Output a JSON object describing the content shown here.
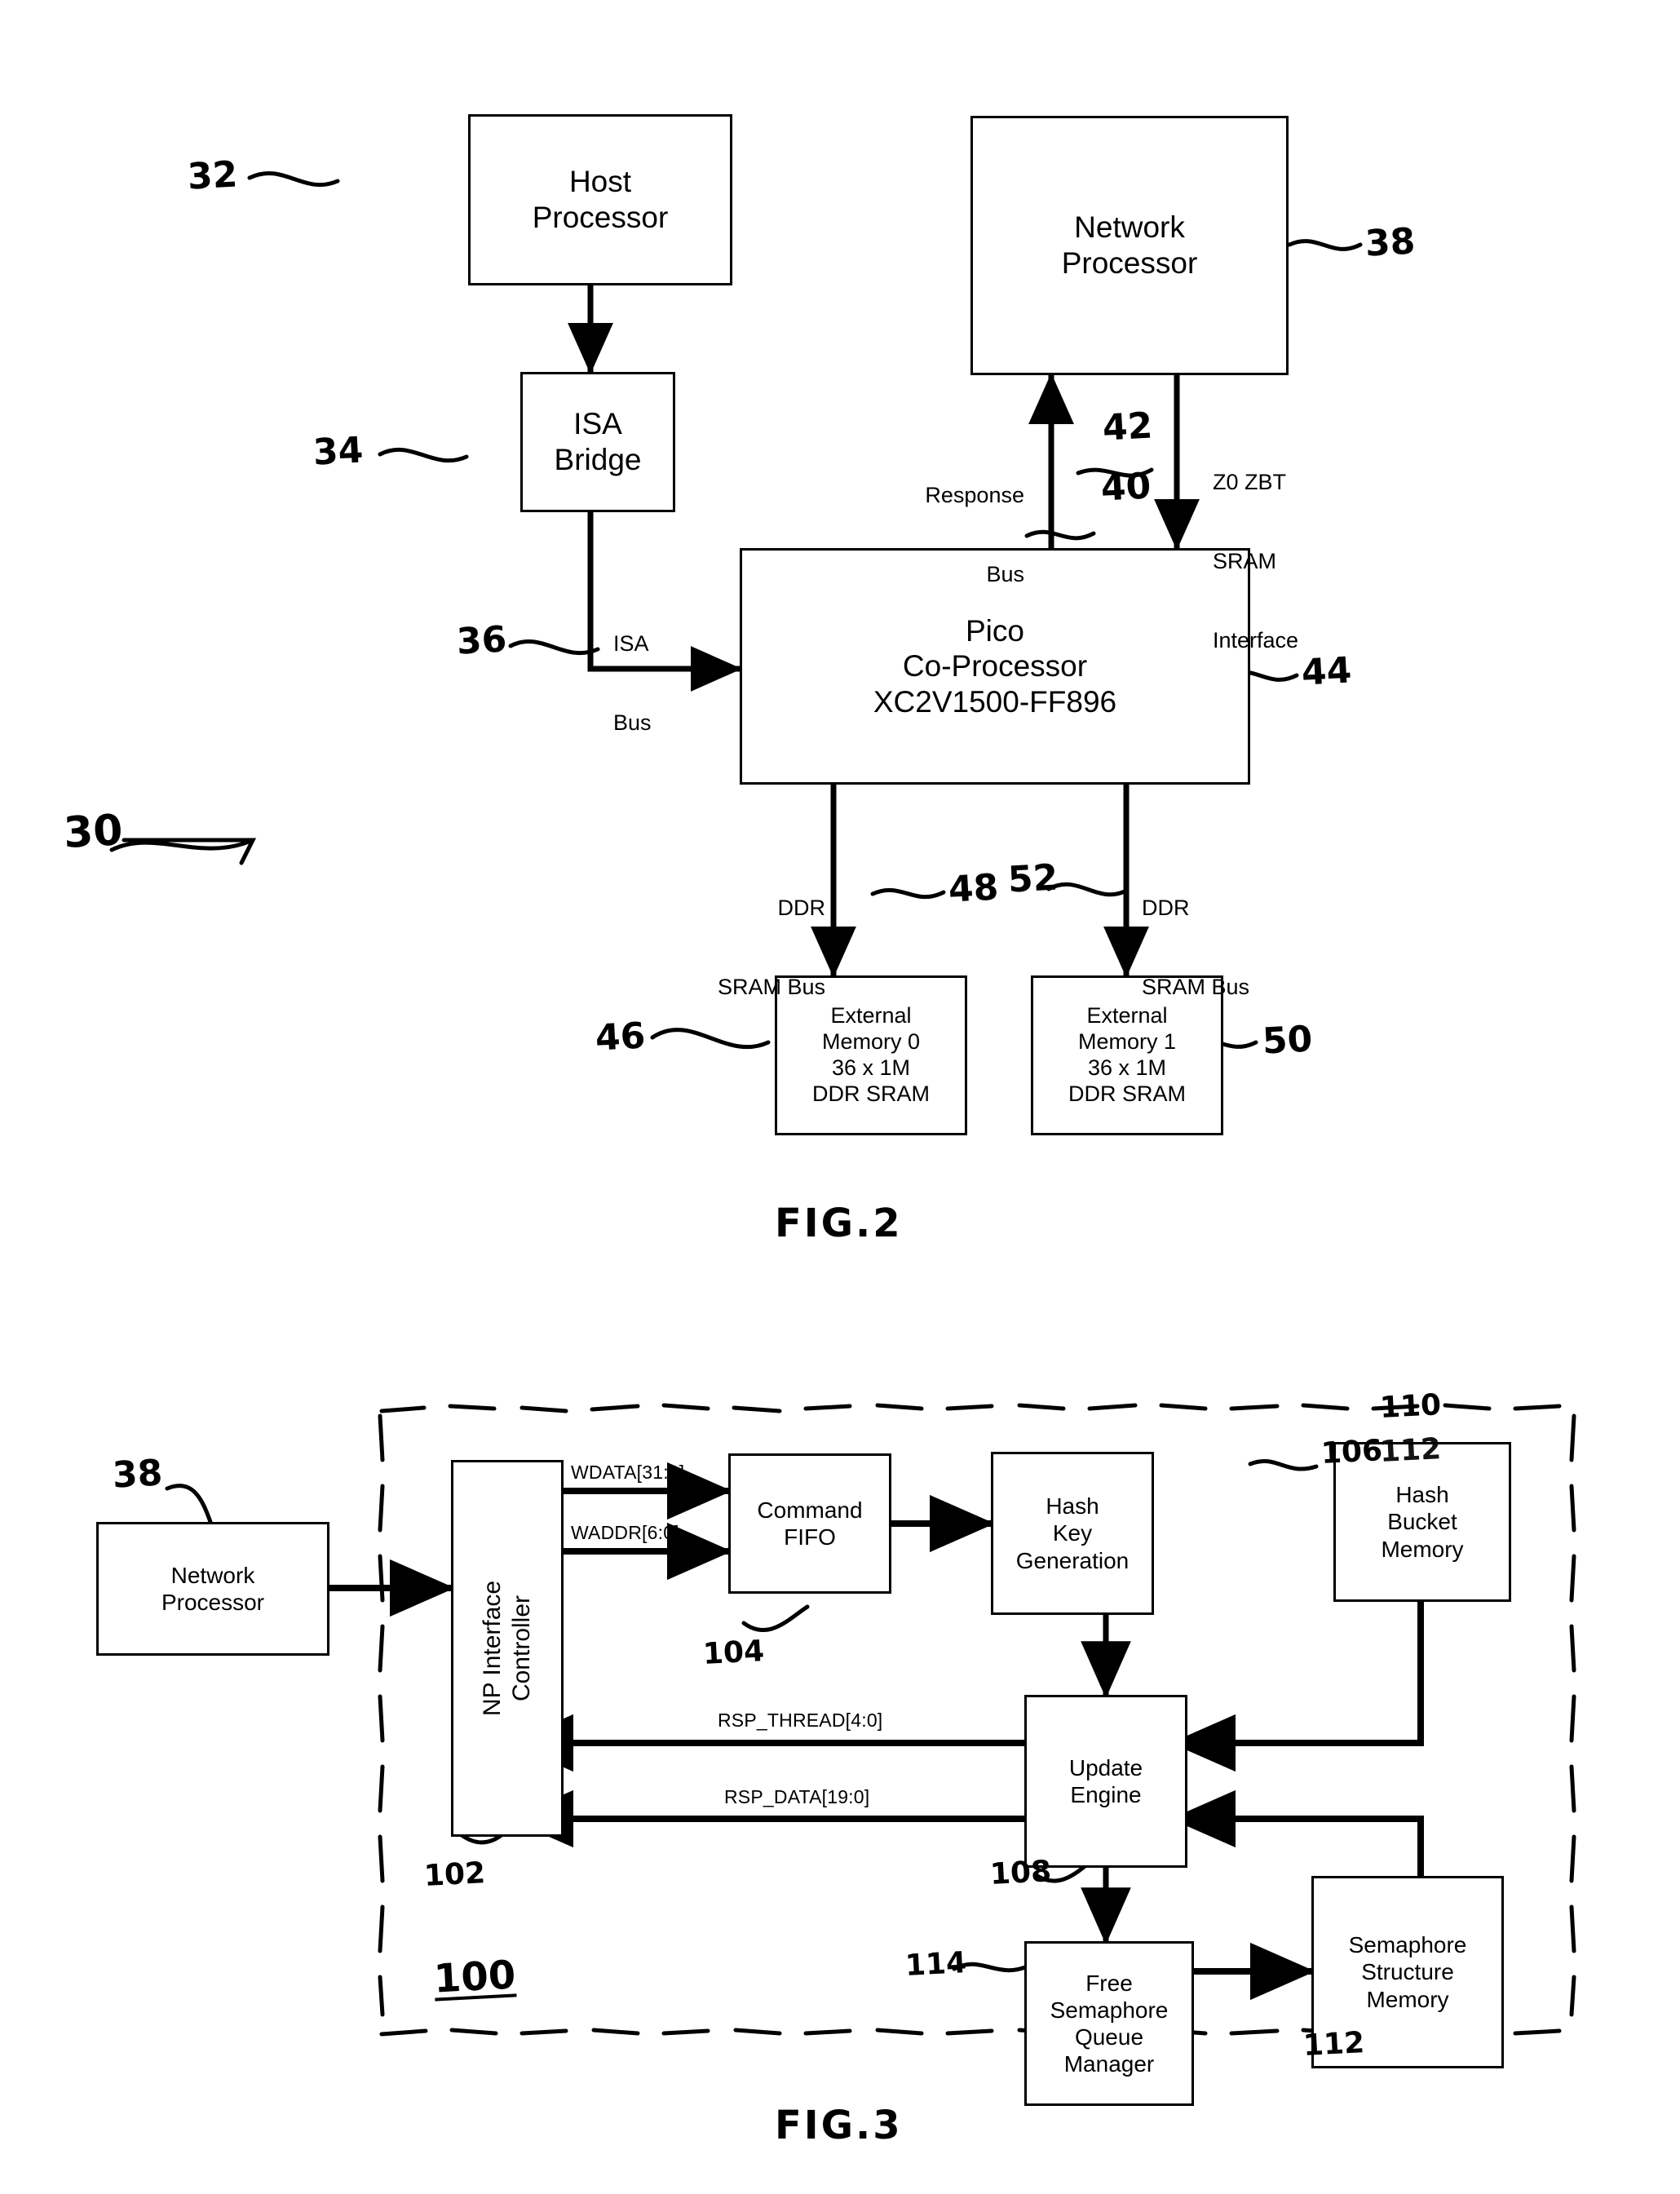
{
  "figures": [
    {
      "caption": "FIG.2",
      "system_ref": "30",
      "blocks": [
        {
          "id": "host_processor",
          "lines": [
            "Host",
            "Processor"
          ],
          "ref": "32"
        },
        {
          "id": "isa_bridge",
          "lines": [
            "ISA",
            "Bridge"
          ],
          "ref": "34"
        },
        {
          "id": "network_processor",
          "lines": [
            "Network",
            "Processor"
          ],
          "ref": "38"
        },
        {
          "id": "pico_coprocessor",
          "lines": [
            "Pico",
            "Co-Processor",
            "XC2V1500-FF896"
          ],
          "ref": "44"
        },
        {
          "id": "external_memory_0",
          "lines": [
            "External",
            "Memory 0",
            "36 x 1M",
            "DDR SRAM"
          ],
          "ref": "46"
        },
        {
          "id": "external_memory_1",
          "lines": [
            "External",
            "Memory 1",
            "36 x 1M",
            "DDR SRAM"
          ],
          "ref": "50"
        }
      ],
      "bus_labels": [
        {
          "id": "isa_bus",
          "lines": [
            "ISA",
            "Bus"
          ],
          "ref": "36"
        },
        {
          "id": "response_bus",
          "lines": [
            "Response",
            "Bus"
          ],
          "ref": "40"
        },
        {
          "id": "zbt_interface",
          "lines": [
            "Z0 ZBT",
            "SRAM",
            "Interface"
          ],
          "ref": "42"
        },
        {
          "id": "ddr_sram_bus_0",
          "lines": [
            "DDR",
            "SRAM Bus"
          ],
          "ref": "48"
        },
        {
          "id": "ddr_sram_bus_1",
          "lines": [
            "DDR",
            "SRAM Bus"
          ],
          "ref": "52"
        }
      ]
    },
    {
      "caption": "FIG.3",
      "system_ref": "100",
      "blocks": [
        {
          "id": "network_processor",
          "lines": [
            "Network",
            "Processor"
          ],
          "ref": "38"
        },
        {
          "id": "np_interface_controller",
          "lines": [
            "NP Interface",
            "Controller"
          ],
          "ref": "102"
        },
        {
          "id": "command_fifo",
          "lines": [
            "Command",
            "FIFO"
          ],
          "ref": "104"
        },
        {
          "id": "hash_key_generation",
          "lines": [
            "Hash",
            "Key",
            "Generation"
          ],
          "ref": "106"
        },
        {
          "id": "hash_bucket_memory",
          "lines": [
            "Hash",
            "Bucket",
            "Memory"
          ],
          "ref": "110"
        },
        {
          "id": "update_engine",
          "lines": [
            "Update",
            "Engine"
          ],
          "ref": "108"
        },
        {
          "id": "semaphore_structure_memory",
          "lines": [
            "Semaphore",
            "Structure",
            "Memory"
          ],
          "ref": "112"
        },
        {
          "id": "free_semaphore_queue_manager",
          "lines": [
            "Free",
            "Semaphore",
            "Queue",
            "Manager"
          ],
          "ref": "114"
        }
      ],
      "signals": [
        {
          "id": "wdata",
          "label": "WDATA[31:0]"
        },
        {
          "id": "waddr",
          "label": "WADDR[6:0]"
        },
        {
          "id": "rsp_thread",
          "label": "RSP_THREAD[4:0]"
        },
        {
          "id": "rsp_data",
          "label": "RSP_DATA[19:0]"
        }
      ],
      "stray_refs": [
        "112"
      ]
    }
  ],
  "colors": {
    "ink": "#000000",
    "paper": "#ffffff"
  }
}
